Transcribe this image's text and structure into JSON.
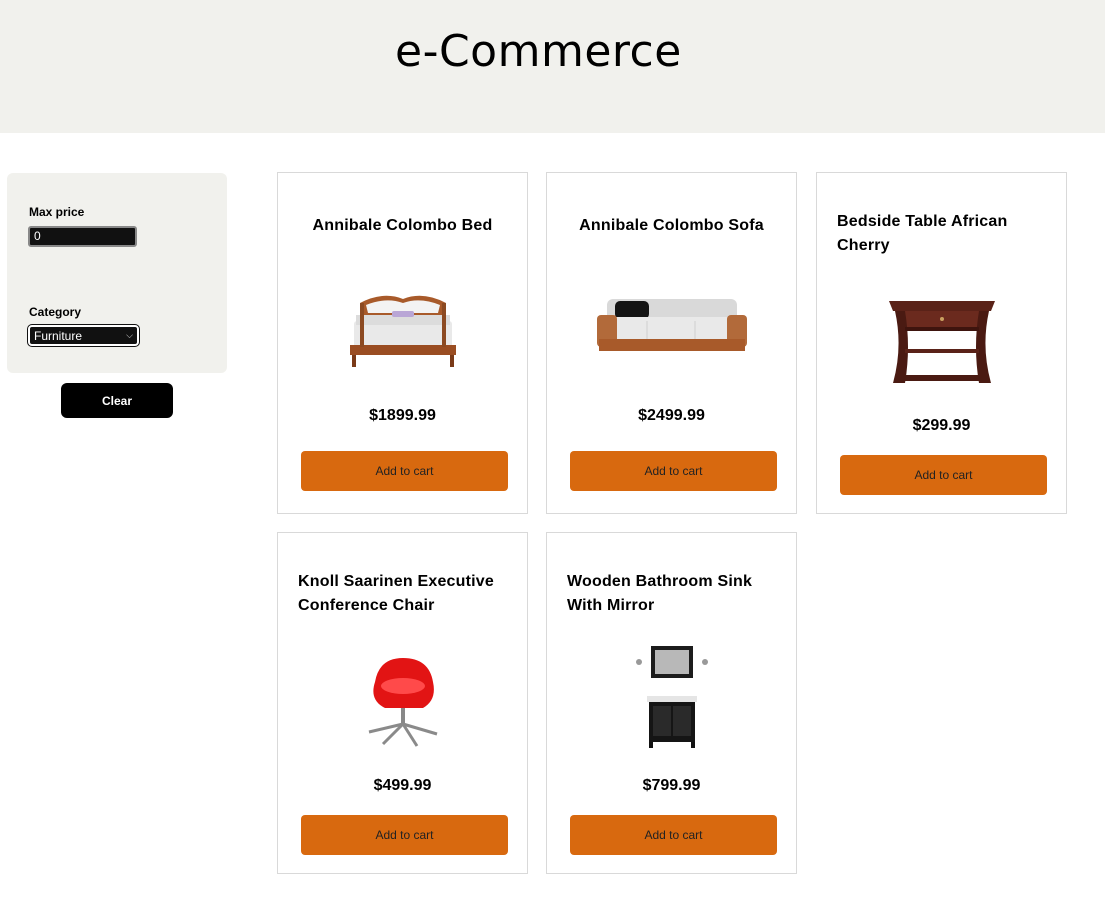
{
  "header": {
    "title": "e-Commerce"
  },
  "filters": {
    "max_price_label": "Max price",
    "max_price_value": "0",
    "category_label": "Category",
    "category_value": "Furniture",
    "clear_label": "Clear"
  },
  "products": [
    {
      "name": "Annibale Colombo Bed",
      "price": "$1899.99",
      "button": "Add to cart",
      "image_icon": "bed-icon"
    },
    {
      "name": "Annibale Colombo Sofa",
      "price": "$2499.99",
      "button": "Add to cart",
      "image_icon": "sofa-icon"
    },
    {
      "name": "Bedside Table African Cherry",
      "price": "$299.99",
      "button": "Add to cart",
      "image_icon": "nightstand-icon"
    },
    {
      "name": "Knoll Saarinen Executive Conference Chair",
      "price": "$499.99",
      "button": "Add to cart",
      "image_icon": "chair-icon"
    },
    {
      "name": "Wooden Bathroom Sink With Mirror",
      "price": "$799.99",
      "button": "Add to cart",
      "image_icon": "sink-mirror-icon"
    }
  ],
  "colors": {
    "accent": "#d8690f",
    "panel": "#f1f1ed"
  }
}
